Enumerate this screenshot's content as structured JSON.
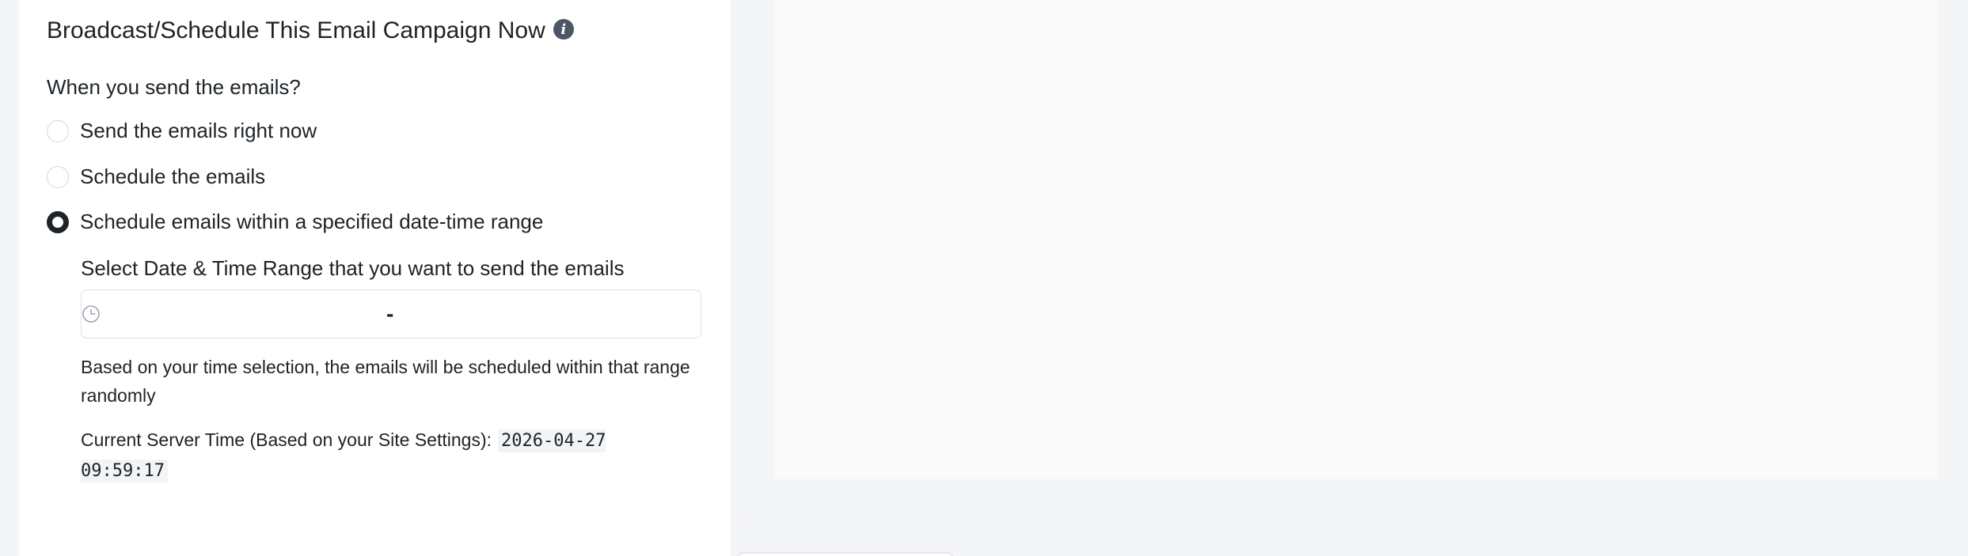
{
  "section": {
    "title": "Broadcast/Schedule This Email Campaign Now",
    "info_icon": "info-icon"
  },
  "question": "When you send the emails?",
  "options": [
    {
      "label": "Send the emails right now",
      "checked": false
    },
    {
      "label": "Schedule the emails",
      "checked": false
    },
    {
      "label": "Schedule emails within a specified date-time range",
      "checked": true
    }
  ],
  "range": {
    "label": "Select Date & Time Range that you want to send the emails",
    "separator": "-",
    "icon": "clock-icon"
  },
  "help_text": "Based on your time selection, the emails will be scheduled within that range randomly",
  "server_time": {
    "label": "Current Server Time (Based on your Site Settings):",
    "value": "2026-04-27 09:59:17"
  }
}
